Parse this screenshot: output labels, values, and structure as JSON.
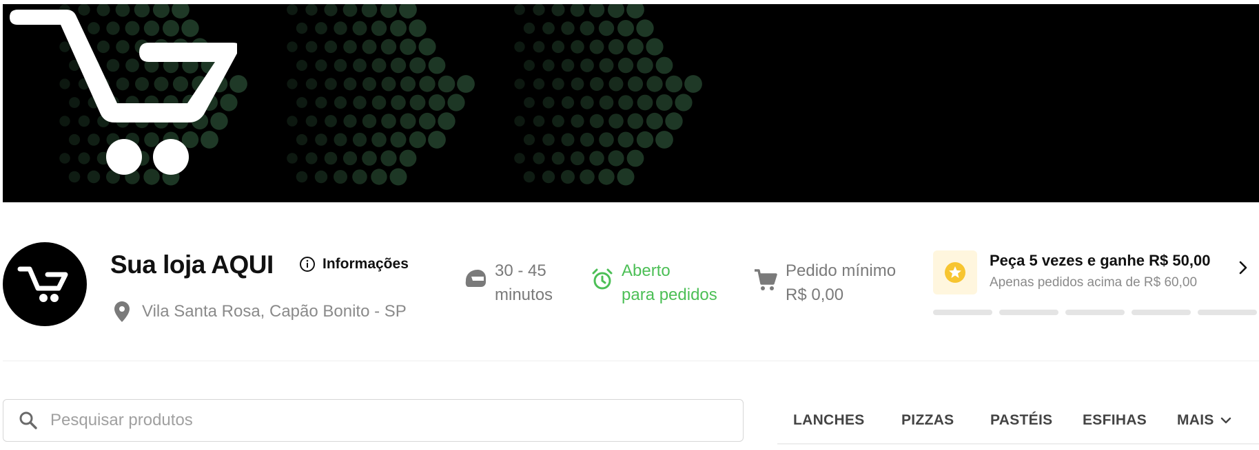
{
  "banner": {
    "background": "#000000",
    "dot_color": "#1f3a27",
    "cart_icon": "cart-icon"
  },
  "store": {
    "name": "Sua loja AQUI",
    "info_label": "Informações",
    "address": "Vila Santa Rosa, Capão Bonito - SP",
    "logo_icon": "cart-icon"
  },
  "delivery": {
    "eta_line1": "30 - 45",
    "eta_line2": "minutos",
    "eta_icon": "motorcycle-helmet-icon"
  },
  "status": {
    "line1": "Aberto",
    "line2": "para pedidos",
    "color": "#4cbf56",
    "icon": "alarm-clock-icon"
  },
  "minimum": {
    "line1": "Pedido mínimo",
    "line2": "R$ 0,00",
    "icon": "shopping-cart-icon"
  },
  "promo": {
    "title": "Peça 5 vezes e ganhe R$ 50,00",
    "subtitle": "Apenas pedidos acima de R$ 60,00",
    "badge_icon": "star-badge-icon",
    "badge_color": "#f7c531",
    "steps_total": 5,
    "steps_done": 0
  },
  "search": {
    "placeholder": "Pesquisar produtos"
  },
  "categories": {
    "items": [
      "LANCHES",
      "PIZZAS",
      "PASTÉIS",
      "ESFIHAS"
    ],
    "more_label": "MAIS"
  }
}
